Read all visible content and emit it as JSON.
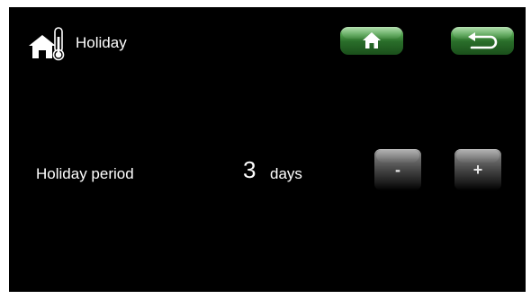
{
  "header": {
    "title": "Holiday",
    "icon": "house-thermometer-icon"
  },
  "nav": {
    "home_icon": "home-icon",
    "back_icon": "back-arrow-icon",
    "accent_color": "#2f7a2f"
  },
  "holiday_period": {
    "label": "Holiday period",
    "value": "3",
    "unit": "days",
    "decrease_label": "-",
    "increase_label": "+"
  }
}
